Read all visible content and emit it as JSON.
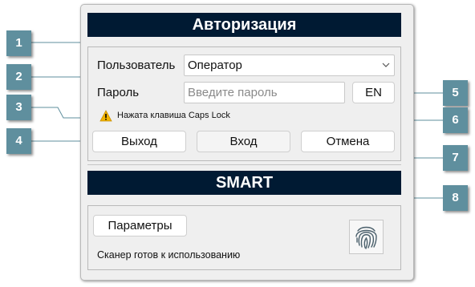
{
  "dialog": {
    "auth_title": "Авторизация",
    "user_label": "Пользователь",
    "user_value": "Оператор",
    "password_label": "Пароль",
    "password_placeholder": "Введите пароль",
    "language_button": "EN",
    "caps_lock_warning": "Нажата клавиша Caps Lock",
    "exit_button": "Выход",
    "login_button": "Вход",
    "cancel_button": "Отмена",
    "smart_title": "SMART",
    "parameters_button": "Параметры",
    "scanner_status": "Сканер готов к использованию"
  },
  "callouts": {
    "c1": "1",
    "c2": "2",
    "c3": "3",
    "c4": "4",
    "c5": "5",
    "c6": "6",
    "c7": "7",
    "c8": "8"
  },
  "icons": {
    "dropdown": "chevron-down-icon",
    "warning": "warning-icon",
    "fingerprint": "fingerprint-icon"
  },
  "colors": {
    "header_bg": "#001a33",
    "callout_bg": "#5f8f9e",
    "warning": "#f2b400"
  }
}
